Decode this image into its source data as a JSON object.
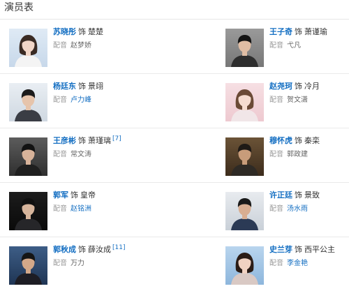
{
  "section_title": "演员表",
  "dub_label": "配音",
  "as_label": "饰",
  "rows": [
    {
      "left": {
        "actor": "苏晓彤",
        "role": "楚楚",
        "ref": "",
        "dub": "赵梦娇",
        "dub_link": false,
        "photo": "female-light"
      },
      "right": {
        "actor": "王子奇",
        "role": "萧谨瑜",
        "ref": "",
        "dub": "弋凡",
        "dub_link": false,
        "photo": "male-gray"
      }
    },
    {
      "left": {
        "actor": "杨廷东",
        "role": "景翊",
        "ref": "",
        "dub": "卢力峰",
        "dub_link": true,
        "photo": "male-light"
      },
      "right": {
        "actor": "赵尧珂",
        "role": "冷月",
        "ref": "",
        "dub": "贺文潇",
        "dub_link": false,
        "photo": "female-pink"
      }
    },
    {
      "left": {
        "actor": "王彦彬",
        "role": "萧瑾璃",
        "ref": "[7]",
        "dub": "常文涛",
        "dub_link": false,
        "photo": "male-dark"
      },
      "right": {
        "actor": "穆怀虎",
        "role": "秦栾",
        "ref": "",
        "dub": "郭政建",
        "dub_link": false,
        "photo": "male-brown"
      }
    },
    {
      "left": {
        "actor": "郭军",
        "role": "皇帝",
        "ref": "",
        "dub": "赵铭洲",
        "dub_link": true,
        "photo": "male-suit-black"
      },
      "right": {
        "actor": "许正廷",
        "role": "景致",
        "ref": "",
        "dub": "汤水雨",
        "dub_link": true,
        "photo": "male-suit-blue"
      }
    },
    {
      "left": {
        "actor": "郭秋成",
        "role": "薛汝成",
        "ref": "[11]",
        "dub": "万力",
        "dub_link": false,
        "photo": "male-blue-bg"
      },
      "right": {
        "actor": "史兰芽",
        "role": "西平公主",
        "ref": "",
        "dub": "李金艳",
        "dub_link": true,
        "photo": "female-blue"
      }
    }
  ],
  "colors": {
    "link": "#136ec2",
    "text": "#333333",
    "muted": "#999999",
    "divider": "#eaeaea"
  }
}
